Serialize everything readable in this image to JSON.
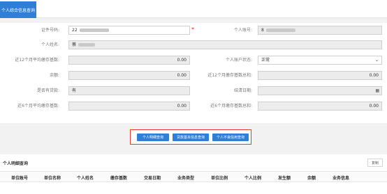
{
  "tab": {
    "label": "个人综合信息查询"
  },
  "form": {
    "id_label": "证件号码:",
    "id_value": "22",
    "id_required": "*",
    "account_label": "个人账号:",
    "account_value": "8",
    "name_label": "个人姓名:",
    "name_value": "蔡",
    "avg12_label": "近12个月平均缴存基数:",
    "avg12_value": "0.00",
    "status_label": "个人账户状态:",
    "status_value": "正常",
    "balance_label": "余额:",
    "balance_value": "0.00",
    "total12_label": "近12个月缴存基数总和:",
    "total12_value": "0.00",
    "loan_label": "是否有贷款:",
    "loan_value": "有",
    "close_date_label": "结清日期:",
    "close_date_value": "",
    "avg6_label": "近6个月平均缴存基数:",
    "avg6_value": "0.00",
    "total6_label": "近6个月缴存基数总和:",
    "total6_value": "0.00"
  },
  "buttons": {
    "detail": "个人明细查询",
    "loan_base": "贷款基本信息查询",
    "credit": "个人不良信用查询"
  },
  "detail_section": {
    "title": "个人明细查询",
    "copy": "复制",
    "columns": [
      "单位账号",
      "单位名称",
      "个人姓名",
      "缴存基数",
      "交易日期",
      "业务类型",
      "单位比例",
      "个人比例",
      "发生额",
      "余额",
      "业务信息"
    ]
  },
  "icons": {
    "calendar": "calendar-icon",
    "dropdown": "chevron-down-icon"
  },
  "colors": {
    "primary": "#2f7fd7",
    "highlight_border": "#e23b3b",
    "required": "#e02020"
  }
}
